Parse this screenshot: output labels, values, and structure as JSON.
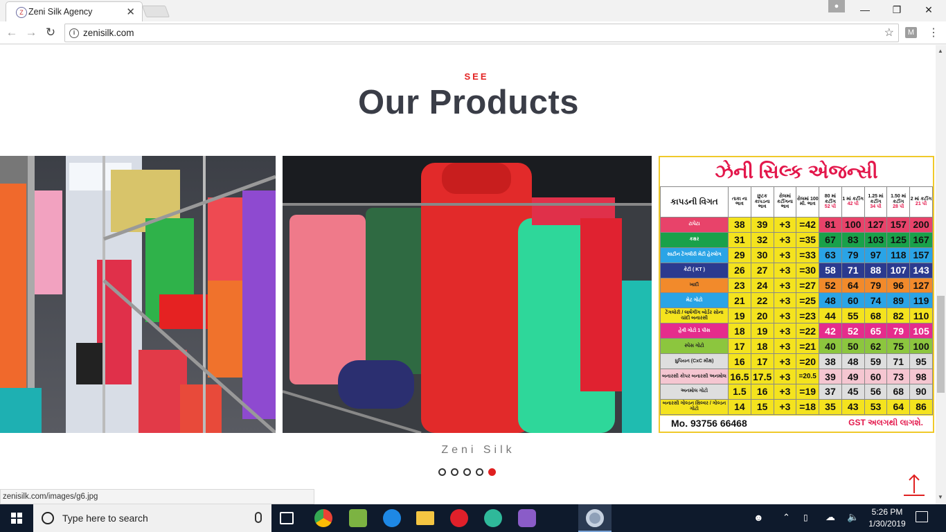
{
  "browser": {
    "tab_title": "Zeni Silk Agency",
    "tab_close": "✕",
    "url": "zenisilk.com",
    "status_url": "zenisilk.com/images/g6.jpg",
    "extension_label": "M",
    "win_minimize": "—",
    "win_restore": "❐",
    "win_close": "✕"
  },
  "section": {
    "eyebrow": "SEE",
    "title": "Our Products"
  },
  "carousel": {
    "caption": "Zeni Silk",
    "total_dots": 5,
    "active_dot": 5
  },
  "price_board": {
    "title": "ઝેની સિલ્ક એજન્સી",
    "header": [
      "કાપડની વિગત",
      "તાકા ના ભાવ",
      "છુટક કાપડના ભાવ",
      "રોલમાં કટીંગના ભાવ",
      "રોલમાં 100 મી. ભાવ",
      "80 માં કટીંગ",
      "1 માં કટીંગ",
      "1.25 માં કટીંગ",
      "1.50 માં કટીંગ",
      "2 માં કટીંગ"
    ],
    "subheader": [
      "52 પી",
      "42 પી",
      "34 પી",
      "28 પી",
      "21 પી"
    ],
    "rows": [
      {
        "name": "ટાપેટા",
        "vals": [
          "38",
          "39",
          "+3",
          "=42",
          "81",
          "100",
          "127",
          "157",
          "200"
        ],
        "color": "#e8436a"
      },
      {
        "name": "કક્ષર",
        "vals": [
          "31",
          "32",
          "+3",
          "=35",
          "67",
          "83",
          "103",
          "125",
          "167"
        ],
        "color": "#19a14a"
      },
      {
        "name": "સાટીન ટેંગલીરી મેટી હેરલોગ",
        "vals": [
          "29",
          "30",
          "+3",
          "=33",
          "63",
          "79",
          "97",
          "118",
          "157"
        ],
        "color": "#2aa4e6"
      },
      {
        "name": "કેટી ( KT )",
        "vals": [
          "26",
          "27",
          "+3",
          "=30",
          "58",
          "71",
          "88",
          "107",
          "143"
        ],
        "color": "#2b3a8f"
      },
      {
        "name": "ખાદી",
        "vals": [
          "23",
          "24",
          "+3",
          "=27",
          "52",
          "64",
          "79",
          "96",
          "127"
        ],
        "color": "#f28a2b"
      },
      {
        "name": "મેટ ગોટો",
        "vals": [
          "21",
          "22",
          "+3",
          "=25",
          "48",
          "60",
          "74",
          "89",
          "119"
        ],
        "color": "#2aa4e6"
      },
      {
        "name": "ટેંગલોરી / લાર્ષગીંગ બોર્ડર સોના ચાંદી બનારસી",
        "vals": [
          "19",
          "20",
          "+3",
          "=23",
          "44",
          "55",
          "68",
          "82",
          "110"
        ],
        "color": "#f4e31e"
      },
      {
        "name": "હેવી ગોટો 1 પીસ",
        "vals": [
          "18",
          "19",
          "+3",
          "=22",
          "42",
          "52",
          "65",
          "79",
          "105"
        ],
        "color": "#e52c8c"
      },
      {
        "name": "સ્પેસ ગોટો",
        "vals": [
          "17",
          "18",
          "+3",
          "=21",
          "40",
          "50",
          "62",
          "75",
          "100"
        ],
        "color": "#8cc63e"
      },
      {
        "name": "ધુપિયન (CxC મીક્ષ)",
        "vals": [
          "16",
          "17",
          "+3",
          "=20",
          "38",
          "48",
          "59",
          "71",
          "95"
        ],
        "color": "#dedede"
      },
      {
        "name": "બનારસી કોપર બનારસી અનમોલ",
        "vals": [
          "16.5",
          "17.5",
          "+3",
          "=20.5",
          "39",
          "49",
          "60",
          "73",
          "98"
        ],
        "color": "#f5c6d1"
      },
      {
        "name": "અનમોલ ગોટો",
        "vals": [
          "1.5",
          "16",
          "+3",
          "=19",
          "37",
          "45",
          "56",
          "68",
          "90"
        ],
        "color": "#dedede"
      },
      {
        "name": "બનારસી ગોલ્ડન સિલ્વર / ગોલ્ડન ગોટો",
        "vals": [
          "14",
          "15",
          "+3",
          "=18",
          "35",
          "43",
          "53",
          "64",
          "86"
        ],
        "color": "#f4e31e"
      }
    ],
    "phone": "Mo. 93756 66468",
    "gst_note": "GST અલગથી લાગશે."
  },
  "taskbar": {
    "search_placeholder": "Type here to search",
    "time": "5:26 PM",
    "date": "1/30/2019"
  },
  "colors": {
    "accent": "#e32222",
    "heading": "#3a3d47",
    "taskbar": "#0e1a2c"
  }
}
